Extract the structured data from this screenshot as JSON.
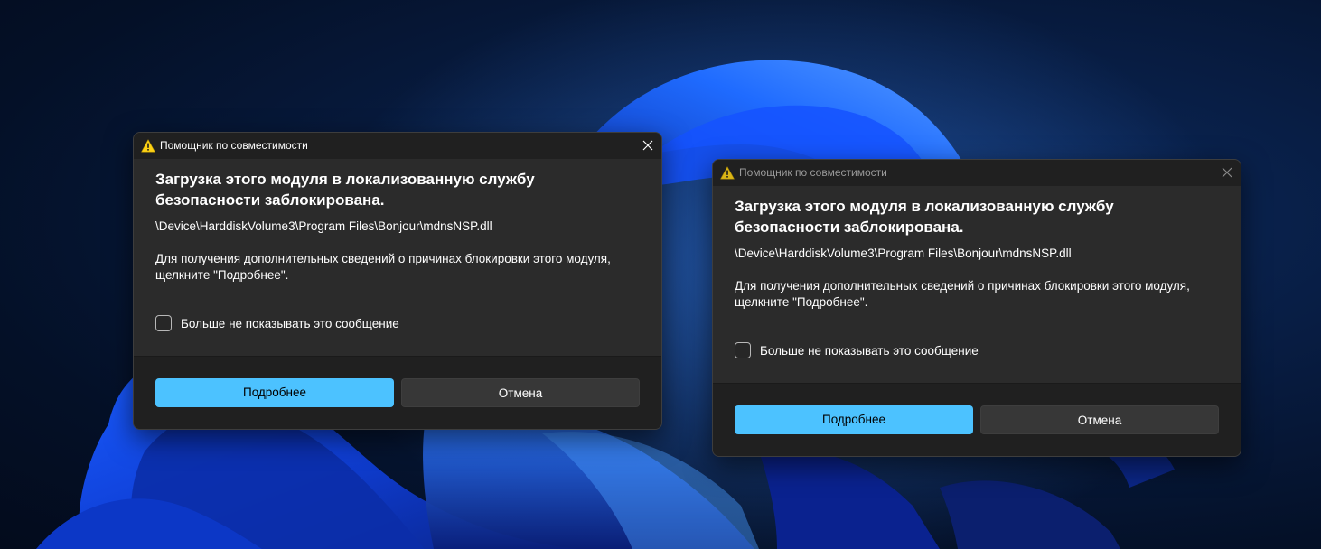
{
  "colors": {
    "accent": "#4cc2ff",
    "dialog_background": "#2b2b2b",
    "titlebar_background": "#202020",
    "warning_icon": "#fcd116"
  },
  "dialogs": [
    {
      "state": "active",
      "title": "Помощник по совместимости",
      "title_icon": "warning-icon",
      "close_icon": "close-icon",
      "heading": "Загрузка этого модуля в локализованную службу безопасности заблокирована.",
      "path": "\\Device\\HarddiskVolume3\\Program Files\\Bonjour\\mdnsNSP.dll",
      "info": "Для получения дополнительных сведений о причинах блокировки этого модуля, щелкните \"Подробнее\".",
      "checkbox_label": "Больше не показывать это сообщение",
      "checkbox_checked": false,
      "primary_button": "Подробнее",
      "secondary_button": "Отмена"
    },
    {
      "state": "inactive",
      "title": "Помощник по совместимости",
      "title_icon": "warning-icon",
      "close_icon": "close-icon",
      "heading": "Загрузка этого модуля в локализованную службу безопасности заблокирована.",
      "path": "\\Device\\HarddiskVolume3\\Program Files\\Bonjour\\mdnsNSP.dll",
      "info": "Для получения дополнительных сведений о причинах блокировки этого модуля, щелкните \"Подробнее\".",
      "checkbox_label": "Больше не показывать это сообщение",
      "checkbox_checked": false,
      "primary_button": "Подробнее",
      "secondary_button": "Отмена"
    }
  ]
}
